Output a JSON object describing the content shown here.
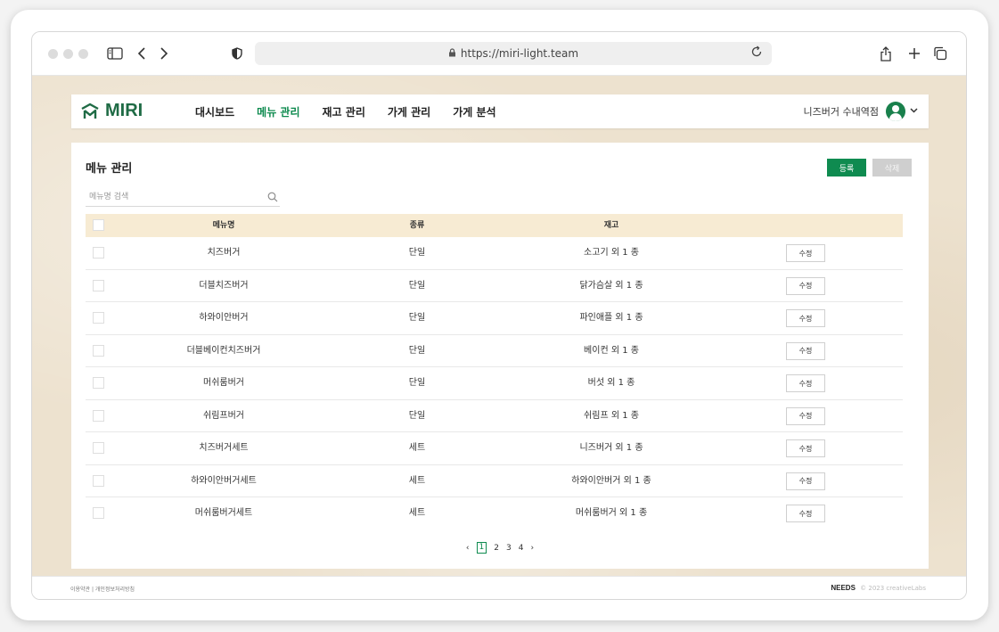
{
  "browser": {
    "url": "https://miri-light.team"
  },
  "app": {
    "logo_text": "MIRI",
    "nav": [
      {
        "label": "대시보드"
      },
      {
        "label": "메뉴 관리"
      },
      {
        "label": "재고 관리"
      },
      {
        "label": "가게 관리"
      },
      {
        "label": "가게 분석"
      }
    ],
    "user_name": "니즈버거 수내역점",
    "accent_color": "#0f8b50"
  },
  "page": {
    "title": "메뉴 관리",
    "register_label": "등록",
    "delete_label": "삭제",
    "search_placeholder": "메뉴명 검색"
  },
  "table": {
    "headers": {
      "name": "메뉴명",
      "type": "종류",
      "stock": "재고"
    },
    "edit_label": "수정",
    "rows": [
      {
        "name": "치즈버거",
        "type": "단일",
        "stock": "소고기 외 1 종"
      },
      {
        "name": "더블치즈버거",
        "type": "단일",
        "stock": "닭가슴살 외 1 종"
      },
      {
        "name": "하와이안버거",
        "type": "단일",
        "stock": "파인애플 외 1 종"
      },
      {
        "name": "더블베이컨치즈버거",
        "type": "단일",
        "stock": "베이컨 외 1 종"
      },
      {
        "name": "머쉬룸버거",
        "type": "단일",
        "stock": "버섯 외 1 종"
      },
      {
        "name": "쉬림프버거",
        "type": "단일",
        "stock": "쉬림프 외 1 종"
      },
      {
        "name": "치즈버거세트",
        "type": "세트",
        "stock": "니즈버거 외 1 종"
      },
      {
        "name": "하와이안버거세트",
        "type": "세트",
        "stock": "하와이안버거 외 1 종"
      },
      {
        "name": "머쉬룸버거세트",
        "type": "세트",
        "stock": "머쉬룸버거 외 1 종"
      }
    ]
  },
  "pagination": {
    "prev": "‹",
    "pages": [
      "1",
      "2",
      "3",
      "4"
    ],
    "next": "›"
  },
  "footer": {
    "links": "이용약관 | 개인정보처리방침",
    "brand": "NEEDS",
    "copyright": "© 2023 creativeLabs"
  }
}
